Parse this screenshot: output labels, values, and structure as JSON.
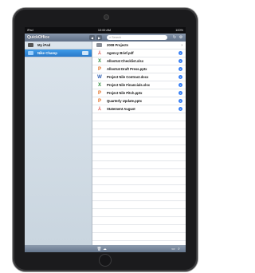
{
  "status_bar": {
    "carrier": "iPad",
    "time": "10:00 AM",
    "battery": "100%"
  },
  "app": {
    "title": "QuickOffice"
  },
  "toolbar": {
    "search_placeholder": "Search"
  },
  "sidebar": {
    "items": [
      {
        "label": "My iPad",
        "icon": "ipad-icon"
      },
      {
        "label": "Nike Champ",
        "icon": "dropbox-icon"
      }
    ]
  },
  "files": [
    {
      "name": "2008 Projects",
      "type": "folder",
      "glyph": "",
      "color": "#8a8f98"
    },
    {
      "name": "Agency Brief.pdf",
      "type": "pdf",
      "glyph": "⅄",
      "color": "#d9534f"
    },
    {
      "name": "Allostrat Checklist.xlsx",
      "type": "excel",
      "glyph": "X",
      "color": "#2e8b3e"
    },
    {
      "name": "Allostrat Draft Press.pptx",
      "type": "powerpoint",
      "glyph": "P",
      "color": "#e06b1c"
    },
    {
      "name": "Project Nile Contract.docx",
      "type": "word",
      "glyph": "W",
      "color": "#2f5fb3"
    },
    {
      "name": "Project Nile Financials.xlsx",
      "type": "excel",
      "glyph": "X",
      "color": "#2e8b3e"
    },
    {
      "name": "Project Nile Pitch.pptx",
      "type": "powerpoint",
      "glyph": "P",
      "color": "#e06b1c"
    },
    {
      "name": "Quarterly Update.pptx",
      "type": "powerpoint",
      "glyph": "P",
      "color": "#e06b1c"
    },
    {
      "name": "Statement August",
      "type": "pdf",
      "glyph": "⅄",
      "color": "#d9534f"
    }
  ]
}
